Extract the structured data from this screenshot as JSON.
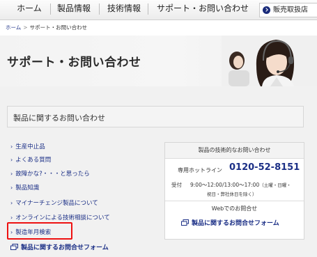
{
  "nav": {
    "items": [
      "ホーム",
      "製品情報",
      "技術情報",
      "サポート・お問い合わせ"
    ],
    "dealer_label": "販売取扱店"
  },
  "breadcrumb": {
    "home": "ホーム",
    "sep": ">",
    "current": "サポート・お問い合わせ"
  },
  "hero": {
    "title": "サポート・お問い合わせ"
  },
  "inquiry": {
    "title": "製品に関するお問い合わせ"
  },
  "links": [
    "生産中止品",
    "よくある質問",
    "故障かな?・・・と思ったら",
    "製品知識",
    "マイナーチェンジ製品について",
    "オンラインによる技術相談について",
    "製造年月検索"
  ],
  "bottom_link": "製品に関するお問合せフォーム",
  "panel": {
    "head": "製品の技術的なお問い合わせ",
    "hotline_label": "専用ホットライン",
    "hotline_number": "0120-52-8151",
    "hours_label": "受付",
    "hours": "9:00～12:00/13:00～17:00",
    "hours_note1": "（土曜・日曜・",
    "hours_note2": "祝日・弊社休日を除く）",
    "web_label": "Webでのお問合せ",
    "web_link": "製品に関するお問合せフォーム"
  },
  "colors": {
    "link": "#1b2f86",
    "highlight": "#ee1111",
    "brand_navy": "#1a2b7a"
  }
}
